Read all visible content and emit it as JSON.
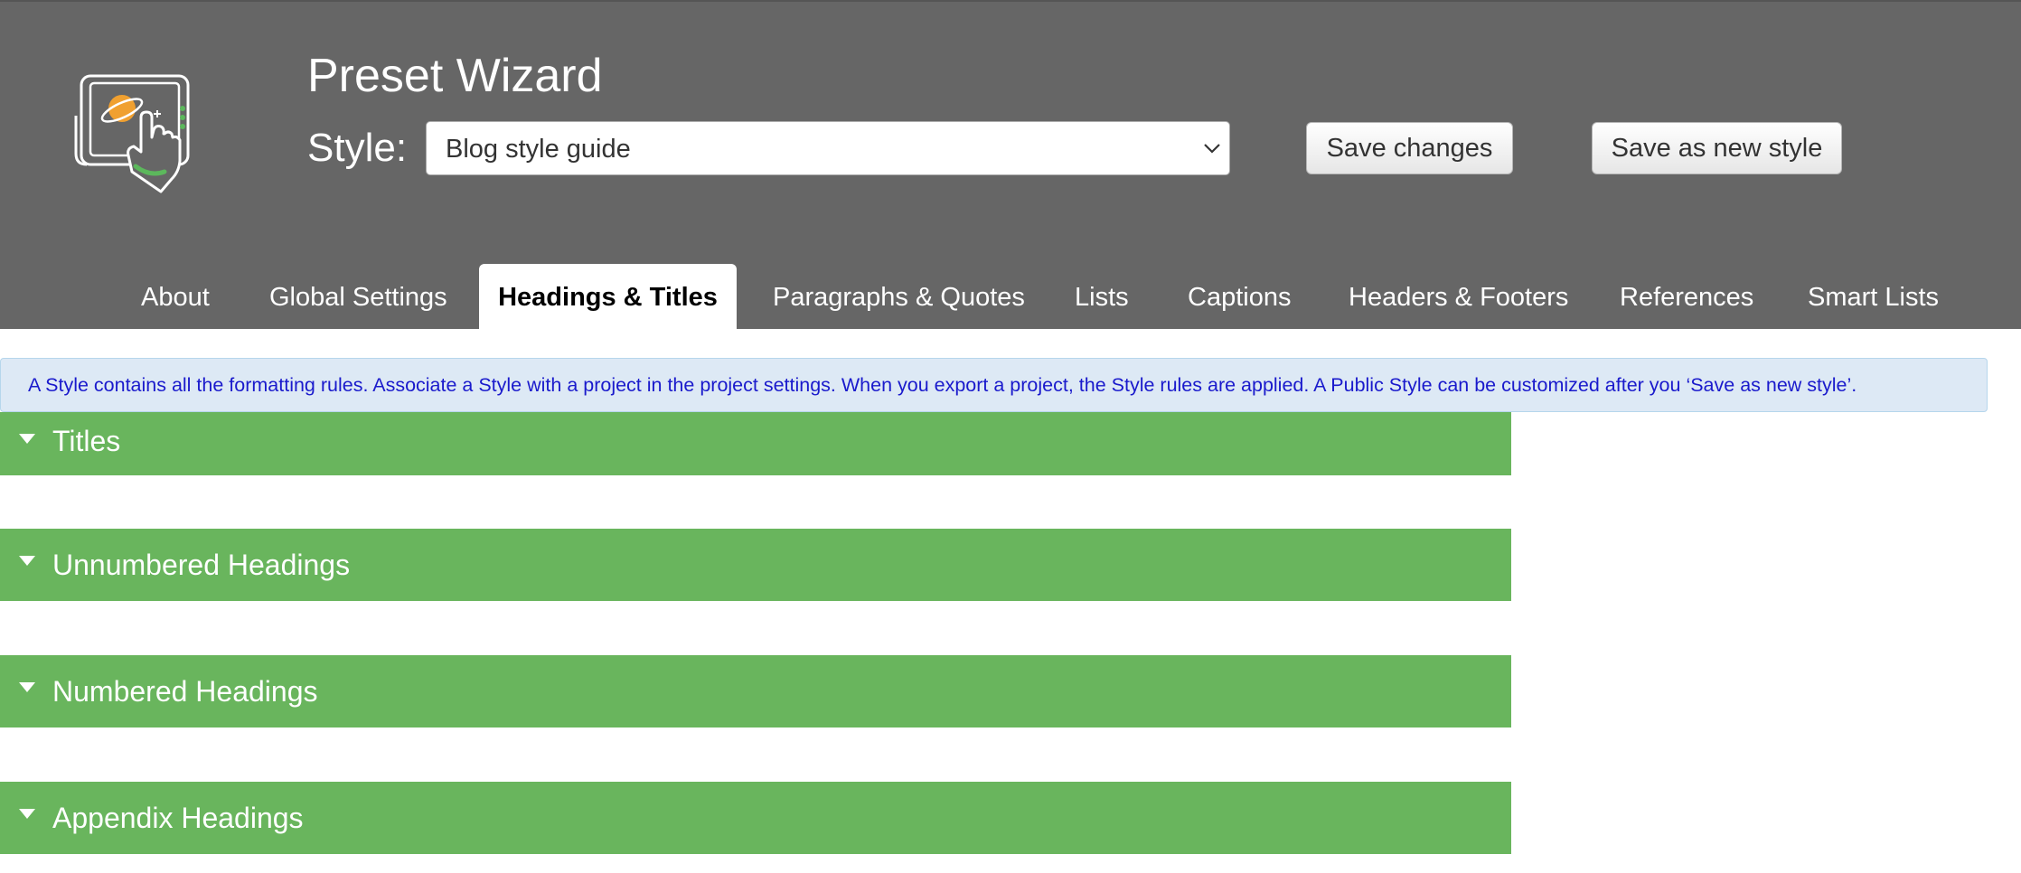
{
  "app": {
    "title": "Preset Wizard",
    "logo_icon": "touch-screen-hand-icon"
  },
  "style_picker": {
    "label": "Style:",
    "selected": "Blog style guide"
  },
  "buttons": {
    "save_changes": "Save changes",
    "save_as_new": "Save as new style"
  },
  "tabs": [
    {
      "label": "About",
      "active": false
    },
    {
      "label": "Global Settings",
      "active": false
    },
    {
      "label": "Headings & Titles",
      "active": true
    },
    {
      "label": "Paragraphs & Quotes",
      "active": false
    },
    {
      "label": "Lists",
      "active": false
    },
    {
      "label": "Captions",
      "active": false
    },
    {
      "label": "Headers & Footers",
      "active": false
    },
    {
      "label": "References",
      "active": false
    },
    {
      "label": "Smart Lists",
      "active": false
    }
  ],
  "info_text": "A Style contains all the formatting rules. Associate a Style with a project in the project settings. When you export a project, the Style rules are applied. A Public Style can be customized after you ‘Save as new style’.",
  "sections": [
    {
      "label": "Titles",
      "expanded": true
    },
    {
      "label": "Unnumbered Headings",
      "expanded": true
    },
    {
      "label": "Numbered Headings",
      "expanded": true
    },
    {
      "label": "Appendix Headings",
      "expanded": true
    }
  ],
  "colors": {
    "header_bg": "#666666",
    "section_bg": "#69b55d",
    "info_bg": "#dde9f5",
    "info_text": "#1a1acc",
    "logo_accent_orange": "#f0a030",
    "logo_accent_green": "#5cb85c"
  }
}
